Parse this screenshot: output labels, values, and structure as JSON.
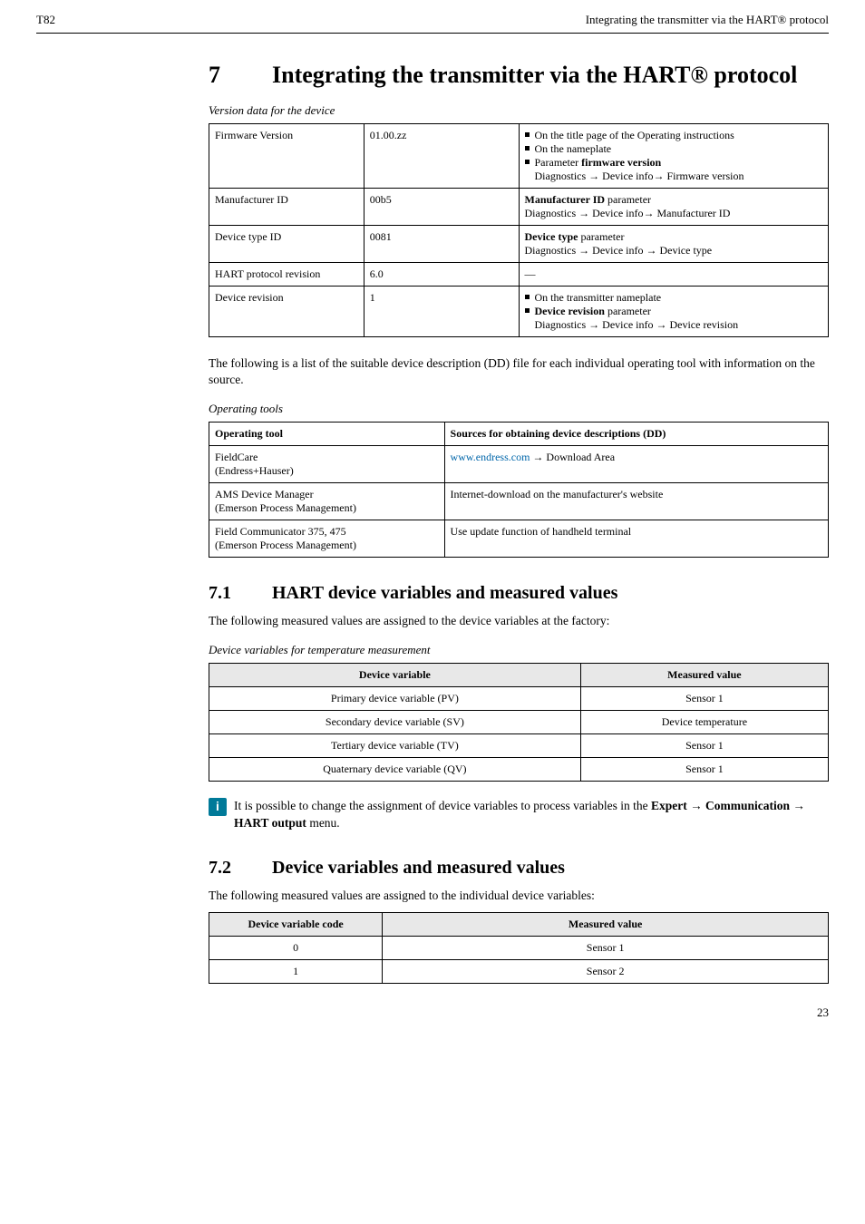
{
  "header": {
    "left": "T82",
    "right": "Integrating the transmitter via the HART® protocol"
  },
  "chapter": {
    "num": "7",
    "title": "Integrating the transmitter via the HART® protocol"
  },
  "versionTable": {
    "caption": "Version data for the device",
    "rows": [
      {
        "c1": "Firmware Version",
        "c2": "01.00.zz",
        "c3_items": [
          "On the title page of the Operating instructions",
          "On the nameplate",
          {
            "prefix": "Parameter ",
            "bold": "firmware version"
          }
        ],
        "c3_path": "Diagnostics → Device info→ Firmware version"
      },
      {
        "c1": "Manufacturer ID",
        "c2": "00b5",
        "c3_lead_bold": "Manufacturer ID",
        "c3_lead_rest": " parameter",
        "c3_path": "Diagnostics → Device info→ Manufacturer ID"
      },
      {
        "c1": "Device type ID",
        "c2": "0081",
        "c3_lead_bold": "Device type",
        "c3_lead_rest": " parameter",
        "c3_path": "Diagnostics → Device info → Device type"
      },
      {
        "c1": "HART protocol revision",
        "c2": "6.0",
        "c3_dash": "—"
      },
      {
        "c1": "Device revision",
        "c2": "1",
        "c3_items": [
          "On the transmitter nameplate",
          {
            "bold": "Device revision",
            "suffix": " parameter"
          }
        ],
        "c3_path": "Diagnostics → Device info → Device revision"
      }
    ]
  },
  "ddIntro": "The following is a list of the suitable device description (DD) file for each individual operating tool with information on the source.",
  "opTable": {
    "caption": "Operating tools",
    "h1": "Operating tool",
    "h2": "Sources for obtaining device descriptions (DD)",
    "rows": [
      {
        "c1a": "FieldCare",
        "c1b": "(Endress+Hauser)",
        "link": "www.endress.com",
        "after": " → Download Area"
      },
      {
        "c1a": "AMS Device Manager",
        "c1b": "(Emerson Process Management)",
        "c2": "Internet-download on the manufacturer's website"
      },
      {
        "c1a": "Field Communicator 375, 475",
        "c1b": "(Emerson Process Management)",
        "c2": "Use update function of handheld terminal"
      }
    ]
  },
  "sec71": {
    "num": "7.1",
    "title": "HART device variables and measured values",
    "intro": "The following measured values are assigned to the device variables at the factory:",
    "caption": "Device variables for temperature measurement",
    "h1": "Device variable",
    "h2": "Measured value",
    "rows": [
      {
        "c1": "Primary device variable (PV)",
        "c2": "Sensor 1"
      },
      {
        "c1": "Secondary device variable (SV)",
        "c2": "Device temperature"
      },
      {
        "c1": "Tertiary device variable (TV)",
        "c2": "Sensor 1"
      },
      {
        "c1": "Quaternary device variable (QV)",
        "c2": "Sensor 1"
      }
    ]
  },
  "infoNote": {
    "prefix": "It is possible to change the assignment of device variables to process variables in the ",
    "bold1": "Expert",
    "arrow1": " → ",
    "bold2": "Communication",
    "arrow2": " → ",
    "bold3": "HART output",
    "suffix": " menu."
  },
  "sec72": {
    "num": "7.2",
    "title": "Device variables and measured values",
    "intro": "The following measured values are assigned to the individual device variables:",
    "h1": "Device variable code",
    "h2": "Measured value",
    "rows": [
      {
        "c1": "0",
        "c2": "Sensor 1"
      },
      {
        "c1": "1",
        "c2": "Sensor 2"
      }
    ]
  },
  "pageNum": "23"
}
